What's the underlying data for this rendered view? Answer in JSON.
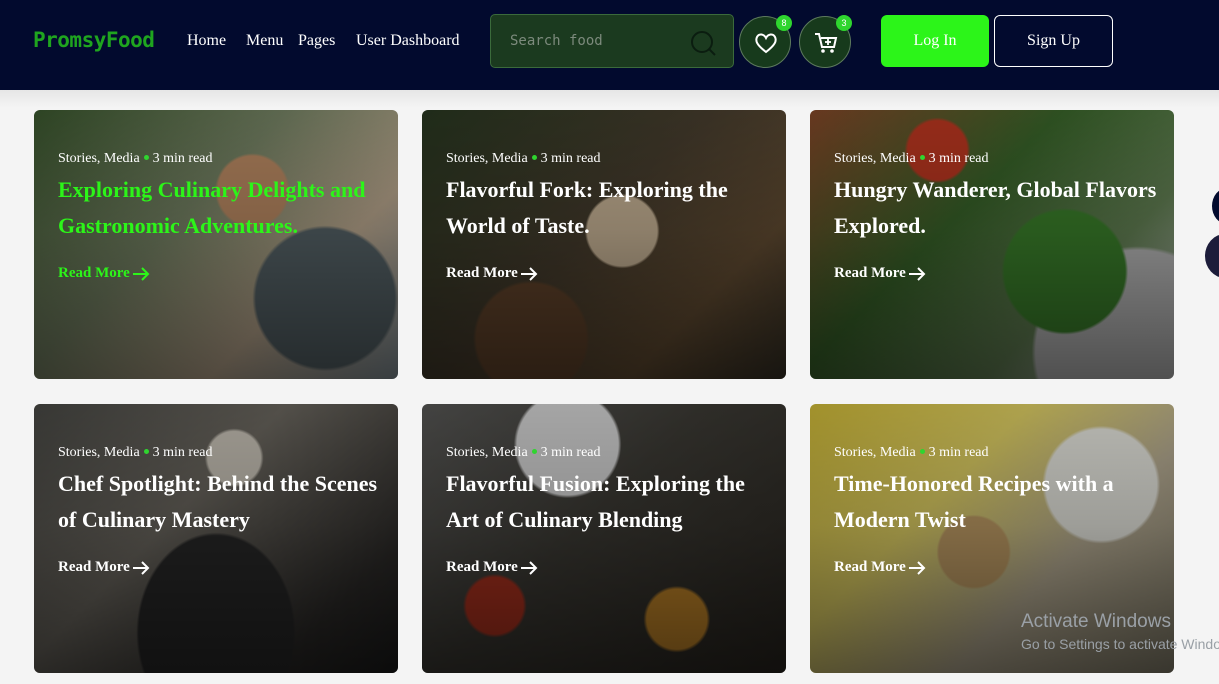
{
  "brand": {
    "logo": "PromsyFood"
  },
  "nav": {
    "items": [
      "Home",
      "Menu",
      "Pages",
      "User Dashboard"
    ]
  },
  "search": {
    "placeholder": "Search food",
    "value": ""
  },
  "wishlist": {
    "count": "8"
  },
  "cart": {
    "count": "3"
  },
  "auth": {
    "login": "Log In",
    "signup": "Sign Up"
  },
  "cards": [
    {
      "category": "Stories, Media",
      "read": "3 min read",
      "title": "Exploring Culinary Delights and Gastronomic Adventures.",
      "cta": "Read More"
    },
    {
      "category": "Stories, Media",
      "read": "3 min read",
      "title": "Flavorful Fork: Exploring the World of Taste.",
      "cta": "Read More"
    },
    {
      "category": "Stories, Media",
      "read": "3 min read",
      "title": "Hungry Wanderer, Global Flavors Explored.",
      "cta": "Read More"
    },
    {
      "category": "Stories, Media",
      "read": "3 min read",
      "title": "Chef Spotlight: Behind the Scenes of Culinary Mastery",
      "cta": "Read More"
    },
    {
      "category": "Stories, Media",
      "read": "3 min read",
      "title": "Flavorful Fusion: Exploring the Art of Culinary Blending",
      "cta": "Read More"
    },
    {
      "category": "Stories, Media",
      "read": "3 min read",
      "title": "Time-Honored Recipes with a Modern Twist",
      "cta": "Read More"
    }
  ],
  "watermark": {
    "line1": "Activate Windows",
    "line2": "Go to Settings to activate Windows."
  },
  "colors": {
    "header_bg": "#020a2e",
    "accent": "#2cf519",
    "logo": "#1fa51f"
  }
}
